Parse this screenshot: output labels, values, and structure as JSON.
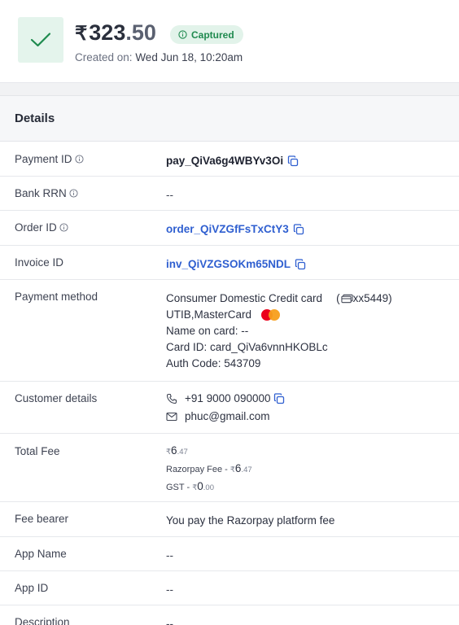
{
  "header": {
    "rupee": "₹",
    "amount_whole": "323",
    "amount_fraction": ".50",
    "status": "Captured",
    "created_label": "Created on:",
    "created_value": "Wed Jun 18, 10:20am"
  },
  "details": {
    "title": "Details",
    "payment_id": {
      "label": "Payment ID",
      "value": "pay_QiVa6g4WBYv3Oi"
    },
    "bank_rrn": {
      "label": "Bank RRN",
      "value": "--"
    },
    "order_id": {
      "label": "Order ID",
      "value": "order_QiVZGfFsTxCtY3"
    },
    "invoice_id": {
      "label": "Invoice ID",
      "value": "inv_QiVZGSOKm65NDL"
    },
    "payment_method": {
      "label": "Payment method",
      "type": "Consumer Domestic Credit card",
      "card_last": "xx5449",
      "network": "UTIB,MasterCard",
      "name_on_card": "Name on card: --",
      "card_id": "Card ID: card_QiVa6vnnHKOBLc",
      "auth_code": "Auth Code: 543709"
    },
    "customer": {
      "label": "Customer details",
      "phone": "+91 9000 090000",
      "email": "phuc@gmail.com"
    },
    "total_fee": {
      "label": "Total Fee",
      "rupee": "₹",
      "total_whole": "6",
      "total_dec": ".47",
      "razorpay_label": "Razorpay Fee - ",
      "razorpay_whole": "6",
      "razorpay_dec": ".47",
      "gst_label": "GST - ",
      "gst_whole": "0",
      "gst_dec": ".00"
    },
    "fee_bearer": {
      "label": "Fee bearer",
      "value": "You pay the Razorpay platform fee"
    },
    "app_name": {
      "label": "App Name",
      "value": "--"
    },
    "app_id": {
      "label": "App ID",
      "value": "--"
    },
    "description": {
      "label": "Description",
      "value": "--"
    }
  },
  "colors": {
    "accent_link": "#2f5fd0",
    "success": "#1f8a4f",
    "success_bg": "#e2f3ea"
  }
}
